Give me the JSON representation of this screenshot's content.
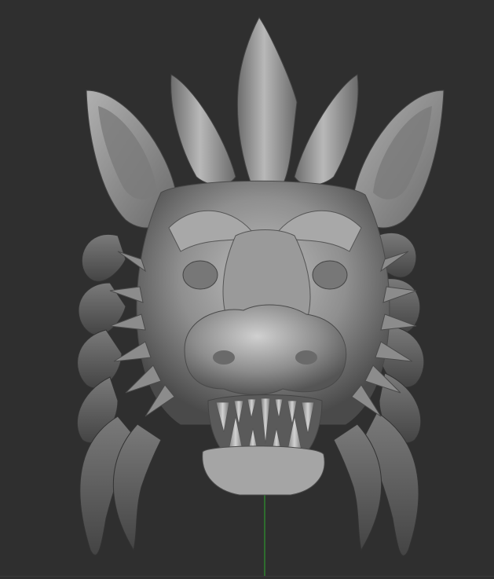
{
  "viewport": {
    "background": "#2f2f2f",
    "axis_color": "#2ea82e",
    "mesh_base_color": "#8a8a8a",
    "mesh_highlight_color": "#c9c9c9",
    "mesh_shadow_color": "#3c3c3c"
  },
  "model": {
    "icon": "dragon-head-sculpt"
  }
}
